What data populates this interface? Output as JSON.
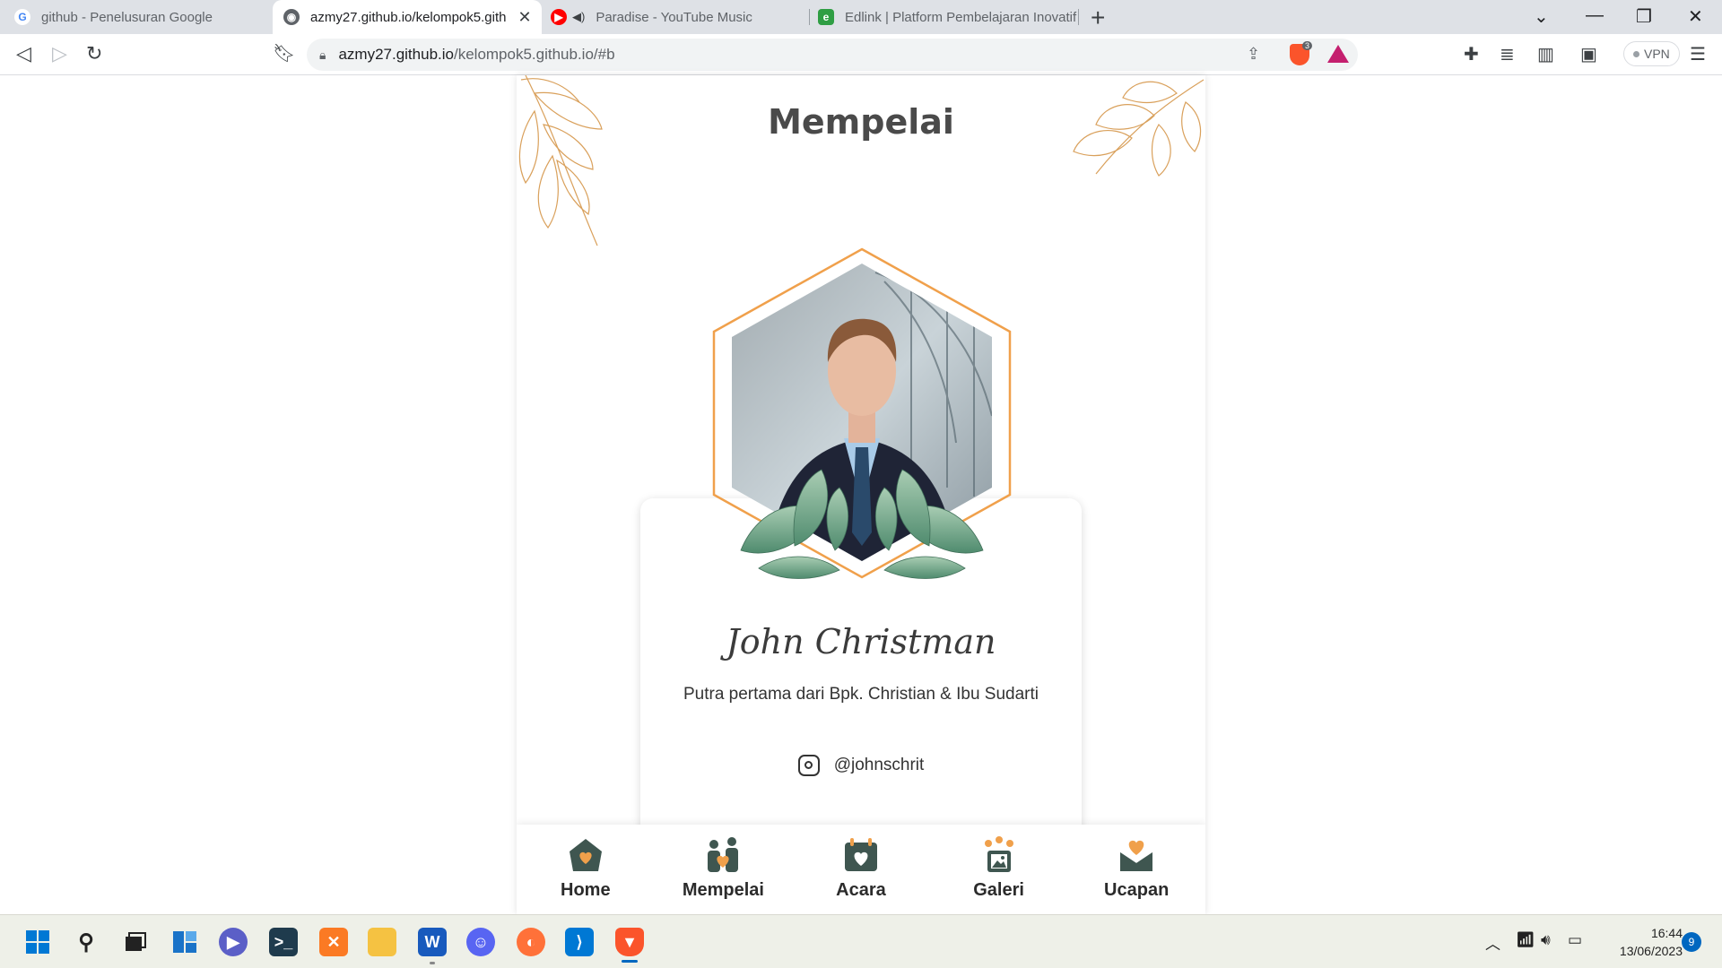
{
  "browser": {
    "tabs": [
      {
        "title": "github - Penelusuran Google",
        "icon": "google-icon"
      },
      {
        "title": "azmy27.github.io/kelompok5.gith",
        "icon": "globe-icon"
      },
      {
        "title": "Paradise - YouTube Music",
        "icon": "youtube-music-icon"
      },
      {
        "title": "Edlink | Platform Pembelajaran Inovatif",
        "icon": "edlink-icon"
      }
    ],
    "url_host": "azmy27.github.io",
    "url_path": "/kelompok5.github.io/#b",
    "vpn_label": "VPN",
    "shield_count": "3"
  },
  "page": {
    "title": "Mempelai",
    "groom": {
      "name": "John Christman",
      "description": "Putra pertama dari Bpk. Christian & Ibu Sudarti",
      "instagram": "@johnschrit"
    },
    "nav": [
      {
        "label": "Home",
        "icon": "home-heart-icon"
      },
      {
        "label": "Mempelai",
        "icon": "couple-icon"
      },
      {
        "label": "Acara",
        "icon": "calendar-heart-icon"
      },
      {
        "label": "Galeri",
        "icon": "gallery-icon"
      },
      {
        "label": "Ucapan",
        "icon": "envelope-heart-icon"
      }
    ],
    "colors": {
      "accent": "#f0a04b",
      "nav_icon": "#3f5650",
      "title": "#4a4a4a"
    }
  },
  "taskbar": {
    "time": "16:44",
    "date": "13/06/2023",
    "notifications": "9"
  }
}
